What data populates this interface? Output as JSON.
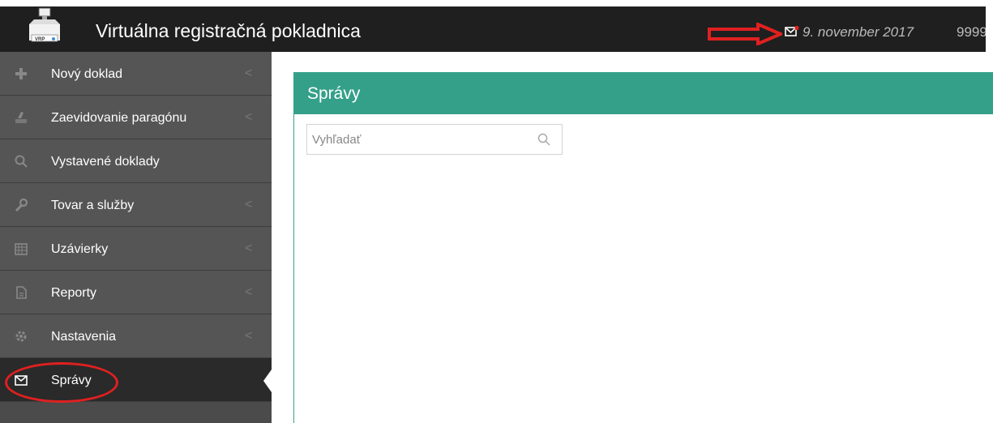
{
  "header": {
    "title": "Virtuálna registračná pokladnica",
    "logo_label": "VRP",
    "date": "9. november 2017",
    "user_id": "9999"
  },
  "sidebar": {
    "items": [
      {
        "label": "Nový doklad",
        "icon": "plus-icon"
      },
      {
        "label": "Zaevidovanie paragónu",
        "icon": "receipt-icon"
      },
      {
        "label": "Vystavené doklady",
        "icon": "search-icon"
      },
      {
        "label": "Tovar a služby",
        "icon": "wrench-icon"
      },
      {
        "label": "Uzávierky",
        "icon": "calendar-icon"
      },
      {
        "label": "Reporty",
        "icon": "document-icon"
      },
      {
        "label": "Nastavenia",
        "icon": "gear-icon"
      },
      {
        "label": "Správy",
        "icon": "envelope-icon"
      }
    ]
  },
  "main": {
    "title": "Správy",
    "search_placeholder": "Vyhľadať"
  },
  "colors": {
    "accent": "#35a08a",
    "topbar": "#1f1f1f",
    "annotation": "#e02020"
  }
}
